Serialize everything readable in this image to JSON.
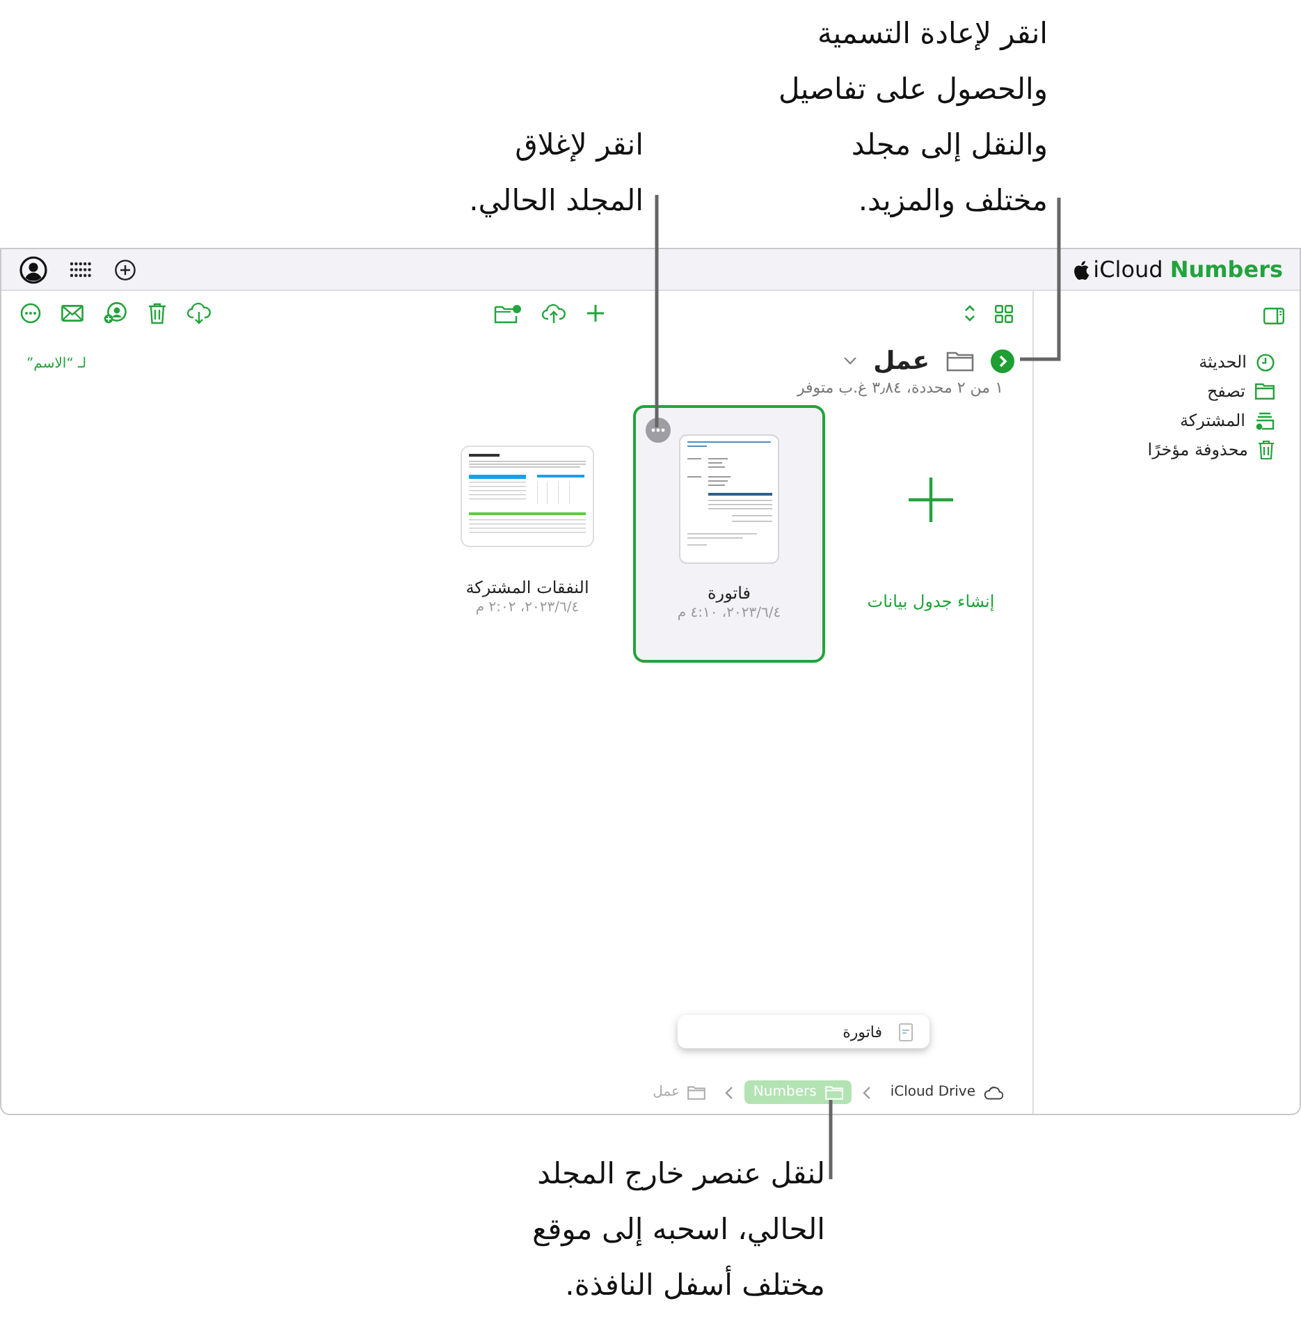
{
  "callouts": [
    {
      "kind": "top",
      "lines": [
        "انقر لإعادة التسمية",
        "والحصول على تفاصيل",
        "والنقل إلى مجلد",
        "مختلف والمزيد."
      ]
    },
    {
      "kind": "top",
      "lines": [
        "انقر لإغلاق",
        "المجلد الحالي."
      ]
    },
    {
      "kind": "bottom",
      "lines": [
        "لنقل عنصر خارج المجلد",
        "الحالي، اسحبه إلى موقع",
        "مختلف أسفل النافذة."
      ]
    }
  ],
  "titlebar": {
    "brand": "iCloud",
    "app": "Numbers"
  },
  "sort_label": "لـ “الاسم”",
  "folder": {
    "name": "عمل",
    "status": "١ من ٢ محددة، ٣٫٨٤ غ.ب متوفر"
  },
  "items": [
    {
      "kind": "create",
      "title": "إنشاء جدول بيانات"
    },
    {
      "kind": "invoice",
      "title": "فاتورة",
      "date": "٢٠٢٣/٦/٤، ٤:١٠ م",
      "selected": true
    },
    {
      "kind": "sheet",
      "title": "النفقات المشتركة",
      "date": "٢٠٢٣/٦/٤، ٢:٠٢ م",
      "selected": false
    }
  ],
  "drag_preview": {
    "title": "فاتورة"
  },
  "breadcrumb": [
    {
      "kind": "cloud",
      "label": "iCloud Drive",
      "highlighted": false,
      "current": false
    },
    {
      "kind": "folder",
      "label": "Numbers",
      "highlighted": true,
      "current": false
    },
    {
      "kind": "folder",
      "label": "عمل",
      "highlighted": false,
      "current": true
    }
  ],
  "sidebar": {
    "items": [
      {
        "kind": "recent",
        "label": "الحديثة"
      },
      {
        "kind": "browse",
        "label": "تصفح"
      },
      {
        "kind": "shared",
        "label": "المشتركة"
      },
      {
        "kind": "deleted",
        "label": "محذوفة مؤخرًا"
      }
    ]
  }
}
